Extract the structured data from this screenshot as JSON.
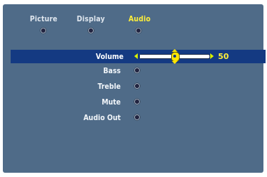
{
  "tabs": [
    {
      "label": "Picture",
      "active": false
    },
    {
      "label": "Display",
      "active": false
    },
    {
      "label": "Audio",
      "active": true
    }
  ],
  "rows": [
    {
      "label": "Volume",
      "selected": true
    },
    {
      "label": "Bass",
      "selected": false
    },
    {
      "label": "Treble",
      "selected": false
    },
    {
      "label": "Mute",
      "selected": false
    },
    {
      "label": "Audio Out",
      "selected": false
    }
  ],
  "volume": {
    "value": "50",
    "level": 0.5
  },
  "colors": {
    "panel": "#4f6b88",
    "highlight": "#143a82",
    "active_text": "#ffef3a",
    "text": "#f2f6fa"
  }
}
